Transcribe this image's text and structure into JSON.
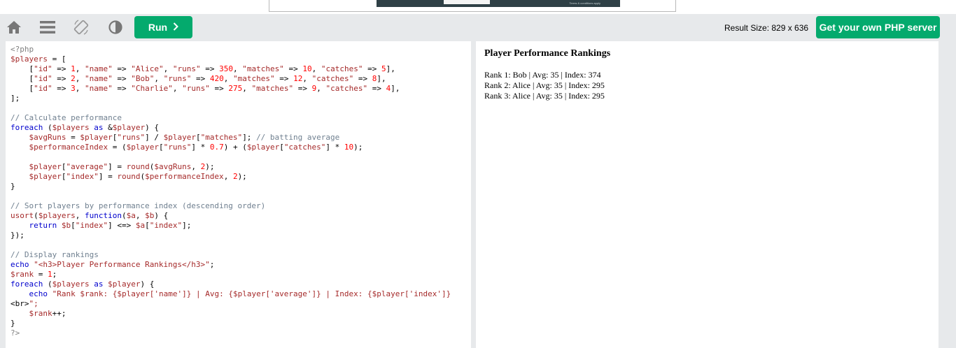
{
  "toolbar": {
    "run_label": "Run",
    "run_chevron": "❯",
    "result_size": "Result Size: 829 x 636",
    "get_server_label": "Get your own PHP server",
    "icons": [
      "home-icon",
      "menu-icon",
      "rotate-icon",
      "theme-contrast-icon"
    ]
  },
  "ad": {
    "fine_print": "Terms & conditions apply"
  },
  "code": {
    "lines": [
      "<?php",
      "$players = [",
      "    [\"id\" => 1, \"name\" => \"Alice\", \"runs\" => 350, \"matches\" => 10, \"catches\" => 5],",
      "    [\"id\" => 2, \"name\" => \"Bob\", \"runs\" => 420, \"matches\" => 12, \"catches\" => 8],",
      "    [\"id\" => 3, \"name\" => \"Charlie\", \"runs\" => 275, \"matches\" => 9, \"catches\" => 4],",
      "];",
      "",
      "// Calculate performance",
      "foreach ($players as &$player) {",
      "    $avgRuns = $player[\"runs\"] / $player[\"matches\"]; // batting average",
      "    $performanceIndex = ($player[\"runs\"] * 0.7) + ($player[\"catches\"] * 10);",
      "",
      "    $player[\"average\"] = round($avgRuns, 2);",
      "    $player[\"index\"] = round($performanceIndex, 2);",
      "}",
      "",
      "// Sort players by performance index (descending order)",
      "usort($players, function($a, $b) {",
      "    return $b[\"index\"] <=> $a[\"index\"];",
      "});",
      "",
      "// Display rankings",
      "echo \"<h3>Player Performance Rankings</h3>\";",
      "$rank = 1;",
      "foreach ($players as $player) {",
      "    echo \"Rank $rank: {$player['name']} | Avg: {$player['average']} | Index: {$player['index']}",
      "<br>\";",
      "    $rank++;",
      "}",
      "?>"
    ]
  },
  "result": {
    "title": "Player Performance Rankings",
    "lines": [
      "Rank 1: Bob | Avg: 35 | Index: 374",
      "Rank 2: Alice | Avg: 35 | Index: 295",
      "Rank 3: Alice | Avg: 35 | Index: 295"
    ]
  },
  "colors": {
    "accent_green": "#04aa6d",
    "toolbar_bg": "#e7e9eb",
    "icon_gray": "#777777"
  }
}
